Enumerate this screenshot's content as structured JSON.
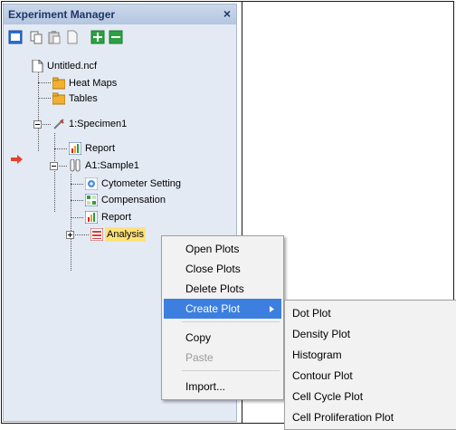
{
  "panel": {
    "title": "Experiment Manager",
    "close_glyph": "×"
  },
  "toolbar": {
    "icons": [
      "panel-toggle-icon",
      "copy-icon",
      "paste-icon",
      "document-icon",
      "add-icon",
      "remove-icon"
    ]
  },
  "tree": {
    "file": "Untitled.ncf",
    "heat_maps": "Heat Maps",
    "tables": "Tables",
    "specimen": "1:Specimen1",
    "specimen_report": "Report",
    "sample": "A1:Sample1",
    "cytometer_setting": "Cytometer Setting",
    "compensation": "Compensation",
    "sample_report": "Report",
    "analysis": "Analysis"
  },
  "context_menu": {
    "open_plots": "Open Plots",
    "close_plots": "Close Plots",
    "delete_plots": "Delete Plots",
    "create_plot": "Create Plot",
    "copy": "Copy",
    "paste": "Paste",
    "import": "Import..."
  },
  "submenu": {
    "items": [
      "Dot Plot",
      "Density Plot",
      "Histogram",
      "Contour Plot",
      "Cell Cycle Plot",
      "Cell Proliferation Plot"
    ]
  },
  "colors": {
    "panel_bg": "#e4eaf4",
    "title_text": "#1f3666",
    "selection": "#ffe27a",
    "menu_highlight": "#3d7fdf",
    "marker": "#e8402a"
  }
}
